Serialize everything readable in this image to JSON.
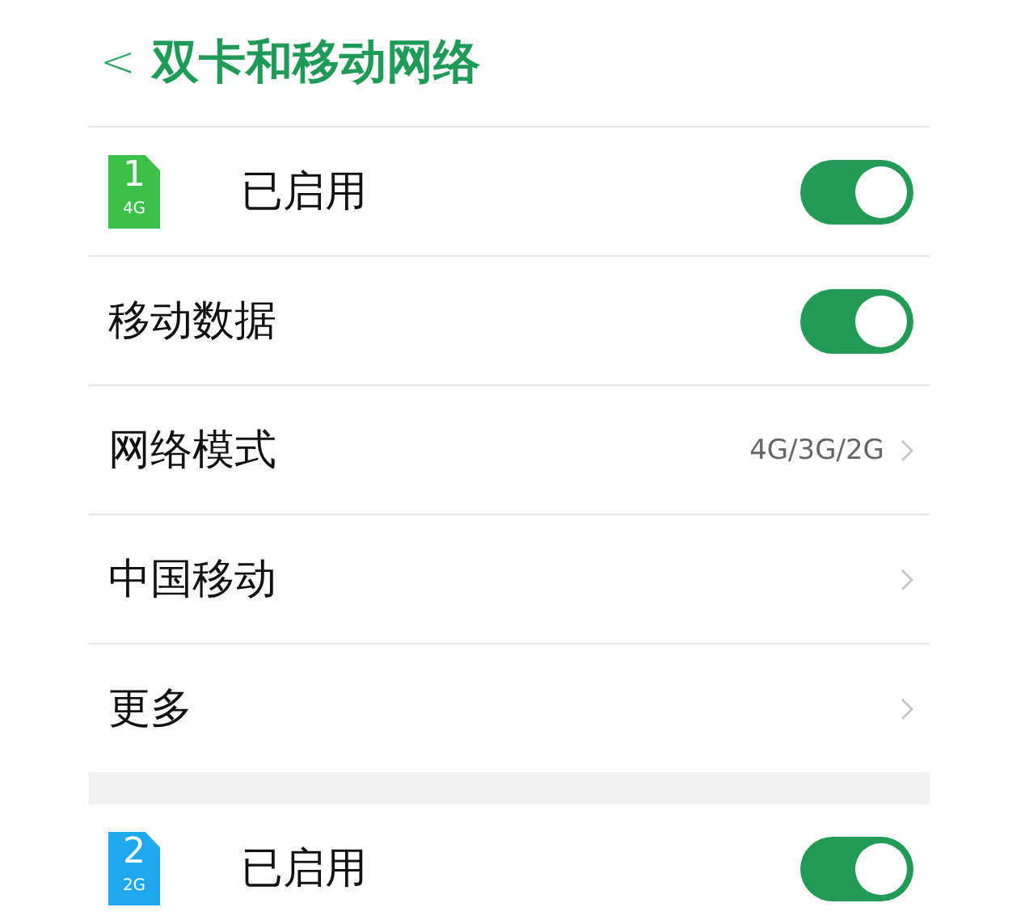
{
  "header": {
    "back": "<",
    "title": "双卡和移动网络"
  },
  "sections": [
    {
      "rows": [
        {
          "kind": "sim",
          "sim_number": "1",
          "network": "4G",
          "color": "#3cc04a",
          "label": "已启用",
          "on": true
        },
        {
          "kind": "toggle",
          "label": "移动数据",
          "on": true
        },
        {
          "kind": "link",
          "label": "网络模式",
          "value": "4G/3G/2G"
        },
        {
          "kind": "link",
          "label": "中国移动"
        },
        {
          "kind": "link",
          "label": "更多"
        }
      ]
    },
    {
      "rows": [
        {
          "kind": "sim",
          "sim_number": "2",
          "network": "2G",
          "color": "#1fa8ee",
          "label": "已启用",
          "on": true
        }
      ]
    }
  ]
}
